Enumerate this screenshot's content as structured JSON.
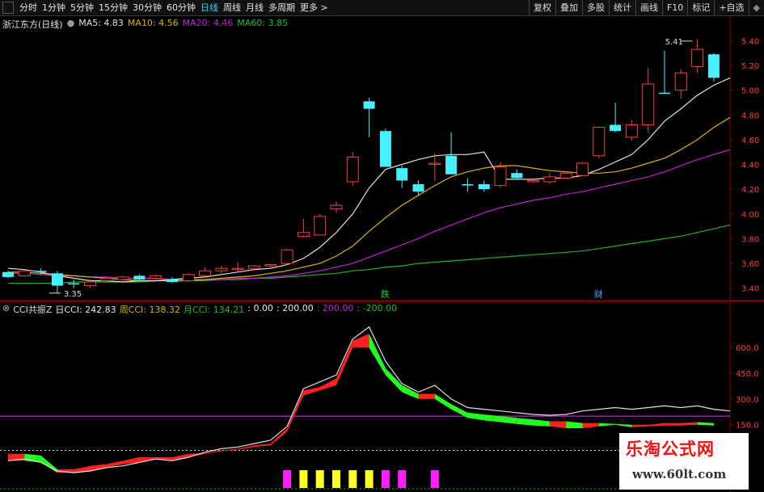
{
  "toolbar": {
    "tabs": [
      "分时",
      "1分钟",
      "5分钟",
      "15分钟",
      "30分钟",
      "60分钟",
      "日线",
      "周线",
      "月线",
      "多周期",
      "更多"
    ],
    "active_tab": "日线",
    "right_buttons": [
      "复权",
      "叠加",
      "多股",
      "统计",
      "画线",
      "F10",
      "标记",
      "+自选",
      "◆"
    ]
  },
  "main_legend": {
    "title": "浙江东方(日线)",
    "ma5": "MA5: 4.83",
    "ma10": "MA10: 4.56",
    "ma20": "MA20: 4.46",
    "ma60": "MA60: 3.85"
  },
  "markers": {
    "high": "5.41",
    "low": "3.35",
    "die": "跌",
    "cai": "财"
  },
  "price_axis": [
    "5.40",
    "5.20",
    "5.00",
    "4.80",
    "4.60",
    "4.40",
    "4.20",
    "4.00",
    "3.80",
    "3.60",
    "3.40"
  ],
  "cci_legend": {
    "name": "CCI共振Z",
    "day": "日CCI: 242.83",
    "week": "周CCI: 138.32",
    "month": "月CCI: 134.21",
    "zero": ": 0.00",
    "c200": ": 200.00",
    "p200": ": 200.00",
    "m200": ": -200.00"
  },
  "cci_axis": [
    "600.0",
    "450.0",
    "300.0",
    "150.0"
  ],
  "watermark": {
    "line1": "乐淘公式网",
    "line2": "www.60lt.com"
  },
  "colors": {
    "up": "#ff3c3c",
    "down": "#46f0ff",
    "ma5": "#e0e0e0",
    "ma10": "#d7b400",
    "ma20": "#c020d0",
    "ma60": "#20b020"
  },
  "chart_data": {
    "type": "candlestick",
    "candles": [
      {
        "o": 3.53,
        "h": 3.54,
        "l": 3.48,
        "c": 3.49
      },
      {
        "o": 3.5,
        "h": 3.55,
        "l": 3.49,
        "c": 3.54
      },
      {
        "o": 3.54,
        "h": 3.56,
        "l": 3.51,
        "c": 3.53
      },
      {
        "o": 3.52,
        "h": 3.54,
        "l": 3.36,
        "c": 3.42
      },
      {
        "o": 3.44,
        "h": 3.47,
        "l": 3.4,
        "c": 3.43
      },
      {
        "o": 3.42,
        "h": 3.47,
        "l": 3.4,
        "c": 3.45
      },
      {
        "o": 3.46,
        "h": 3.49,
        "l": 3.44,
        "c": 3.48
      },
      {
        "o": 3.47,
        "h": 3.5,
        "l": 3.44,
        "c": 3.49
      },
      {
        "o": 3.5,
        "h": 3.51,
        "l": 3.46,
        "c": 3.47
      },
      {
        "o": 3.48,
        "h": 3.51,
        "l": 3.47,
        "c": 3.5
      },
      {
        "o": 3.47,
        "h": 3.49,
        "l": 3.44,
        "c": 3.45
      },
      {
        "o": 3.46,
        "h": 3.52,
        "l": 3.45,
        "c": 3.51
      },
      {
        "o": 3.5,
        "h": 3.57,
        "l": 3.49,
        "c": 3.54
      },
      {
        "o": 3.54,
        "h": 3.58,
        "l": 3.52,
        "c": 3.56
      },
      {
        "o": 3.56,
        "h": 3.61,
        "l": 3.53,
        "c": 3.56
      },
      {
        "o": 3.56,
        "h": 3.59,
        "l": 3.54,
        "c": 3.58
      },
      {
        "o": 3.58,
        "h": 3.59,
        "l": 3.56,
        "c": 3.59
      },
      {
        "o": 3.6,
        "h": 3.72,
        "l": 3.59,
        "c": 3.71
      },
      {
        "o": 3.82,
        "h": 3.96,
        "l": 3.81,
        "c": 3.85
      },
      {
        "o": 3.83,
        "h": 4.0,
        "l": 3.83,
        "c": 3.98
      },
      {
        "o": 4.04,
        "h": 4.1,
        "l": 4.01,
        "c": 4.07
      },
      {
        "o": 4.26,
        "h": 4.5,
        "l": 4.23,
        "c": 4.46
      },
      {
        "o": 4.91,
        "h": 4.94,
        "l": 4.62,
        "c": 4.85
      },
      {
        "o": 4.67,
        "h": 4.69,
        "l": 4.38,
        "c": 4.38
      },
      {
        "o": 4.37,
        "h": 4.39,
        "l": 4.21,
        "c": 4.27
      },
      {
        "o": 4.24,
        "h": 4.27,
        "l": 4.15,
        "c": 4.18
      },
      {
        "o": 4.41,
        "h": 4.49,
        "l": 4.27,
        "c": 4.41
      },
      {
        "o": 4.47,
        "h": 4.66,
        "l": 4.32,
        "c": 4.32
      },
      {
        "o": 4.24,
        "h": 4.29,
        "l": 4.18,
        "c": 4.23
      },
      {
        "o": 4.24,
        "h": 4.27,
        "l": 4.18,
        "c": 4.2
      },
      {
        "o": 4.23,
        "h": 4.42,
        "l": 4.21,
        "c": 4.38
      },
      {
        "o": 4.33,
        "h": 4.36,
        "l": 4.28,
        "c": 4.29
      },
      {
        "o": 4.26,
        "h": 4.29,
        "l": 4.25,
        "c": 4.27
      },
      {
        "o": 4.26,
        "h": 4.33,
        "l": 4.24,
        "c": 4.3
      },
      {
        "o": 4.29,
        "h": 4.34,
        "l": 4.28,
        "c": 4.33
      },
      {
        "o": 4.31,
        "h": 4.42,
        "l": 4.31,
        "c": 4.41
      },
      {
        "o": 4.47,
        "h": 4.71,
        "l": 4.45,
        "c": 4.7
      },
      {
        "o": 4.72,
        "h": 4.9,
        "l": 4.66,
        "c": 4.67
      },
      {
        "o": 4.62,
        "h": 4.76,
        "l": 4.59,
        "c": 4.72
      },
      {
        "o": 4.72,
        "h": 5.18,
        "l": 4.66,
        "c": 5.05
      },
      {
        "o": 4.98,
        "h": 5.32,
        "l": 4.98,
        "c": 4.97
      },
      {
        "o": 5.0,
        "h": 5.17,
        "l": 4.93,
        "c": 5.14
      },
      {
        "o": 5.19,
        "h": 5.41,
        "l": 5.14,
        "c": 5.33
      },
      {
        "o": 5.29,
        "h": 5.3,
        "l": 5.07,
        "c": 5.1
      }
    ],
    "ma5": [
      3.56,
      3.55,
      3.53,
      3.5,
      3.48,
      3.46,
      3.46,
      3.45,
      3.46,
      3.46,
      3.47,
      3.48,
      3.49,
      3.51,
      3.53,
      3.55,
      3.56,
      3.59,
      3.64,
      3.73,
      3.85,
      4.0,
      4.21,
      4.36,
      4.4,
      4.44,
      4.47,
      4.48,
      4.48,
      4.5,
      4.28,
      4.28,
      4.28,
      4.29,
      4.29,
      4.31,
      4.36,
      4.42,
      4.48,
      4.6,
      4.75,
      4.85,
      4.96,
      5.04,
      5.1
    ],
    "ma10": [
      3.53,
      3.53,
      3.52,
      3.51,
      3.5,
      3.49,
      3.48,
      3.47,
      3.46,
      3.46,
      3.46,
      3.46,
      3.47,
      3.48,
      3.49,
      3.5,
      3.52,
      3.54,
      3.57,
      3.6,
      3.66,
      3.74,
      3.86,
      3.97,
      4.07,
      4.15,
      4.23,
      4.3,
      4.34,
      4.37,
      4.39,
      4.39,
      4.37,
      4.35,
      4.34,
      4.33,
      4.33,
      4.34,
      4.37,
      4.41,
      4.45,
      4.52,
      4.6,
      4.7,
      4.78
    ],
    "ma20": [
      3.52,
      3.52,
      3.51,
      3.5,
      3.5,
      3.49,
      3.49,
      3.48,
      3.48,
      3.48,
      3.47,
      3.47,
      3.47,
      3.47,
      3.48,
      3.48,
      3.49,
      3.5,
      3.52,
      3.54,
      3.57,
      3.6,
      3.65,
      3.7,
      3.75,
      3.8,
      3.86,
      3.91,
      3.96,
      4.01,
      4.05,
      4.08,
      4.11,
      4.13,
      4.16,
      4.18,
      4.21,
      4.24,
      4.27,
      4.3,
      4.34,
      4.39,
      4.44,
      4.48,
      4.52
    ],
    "ma60": [
      3.44,
      3.44,
      3.44,
      3.44,
      3.45,
      3.45,
      3.45,
      3.45,
      3.45,
      3.46,
      3.46,
      3.46,
      3.46,
      3.47,
      3.47,
      3.48,
      3.48,
      3.49,
      3.5,
      3.51,
      3.52,
      3.54,
      3.55,
      3.57,
      3.58,
      3.6,
      3.61,
      3.62,
      3.63,
      3.64,
      3.65,
      3.66,
      3.67,
      3.68,
      3.69,
      3.7,
      3.72,
      3.74,
      3.76,
      3.78,
      3.8,
      3.82,
      3.85,
      3.88,
      3.91
    ],
    "price_range": [
      3.3,
      5.52
    ],
    "cci_day": [
      -60,
      -50,
      -70,
      -120,
      -130,
      -120,
      -100,
      -90,
      -70,
      -50,
      -60,
      -40,
      -10,
      10,
      20,
      40,
      60,
      140,
      360,
      400,
      440,
      650,
      720,
      520,
      390,
      340,
      380,
      300,
      250,
      240,
      230,
      220,
      210,
      205,
      210,
      230,
      240,
      250,
      240,
      250,
      260,
      250,
      260,
      240,
      230
    ],
    "cci_upper": [
      -20,
      -20,
      -30,
      -110,
      -110,
      -90,
      -80,
      -60,
      -40,
      -40,
      -40,
      -20,
      -15,
      0,
      10,
      30,
      40,
      130,
      350,
      370,
      420,
      640,
      680,
      480,
      380,
      330,
      330,
      270,
      220,
      210,
      200,
      190,
      180,
      170,
      170,
      160,
      160,
      155,
      150,
      150,
      160,
      160,
      165,
      160,
      150
    ],
    "cci_lower": [
      -60,
      -60,
      -70,
      -130,
      -130,
      -120,
      -100,
      -80,
      -70,
      -50,
      -60,
      -40,
      -20,
      -5,
      5,
      20,
      30,
      110,
      320,
      350,
      380,
      600,
      600,
      440,
      340,
      300,
      300,
      240,
      190,
      175,
      165,
      155,
      145,
      140,
      130,
      130,
      140,
      150,
      135,
      140,
      145,
      145,
      150,
      145,
      130
    ],
    "cci_range": [
      -200,
      780
    ],
    "signal_bars": [
      {
        "i": 17,
        "c": "#ff20ff"
      },
      {
        "i": 18,
        "c": "#ffff20"
      },
      {
        "i": 19,
        "c": "#ffff20"
      },
      {
        "i": 20,
        "c": "#ffff20"
      },
      {
        "i": 21,
        "c": "#ffff20"
      },
      {
        "i": 22,
        "c": "#ffff20"
      },
      {
        "i": 23,
        "c": "#ff20ff"
      },
      {
        "i": 24,
        "c": "#ff20ff"
      },
      {
        "i": 26,
        "c": "#ff20ff"
      }
    ]
  }
}
